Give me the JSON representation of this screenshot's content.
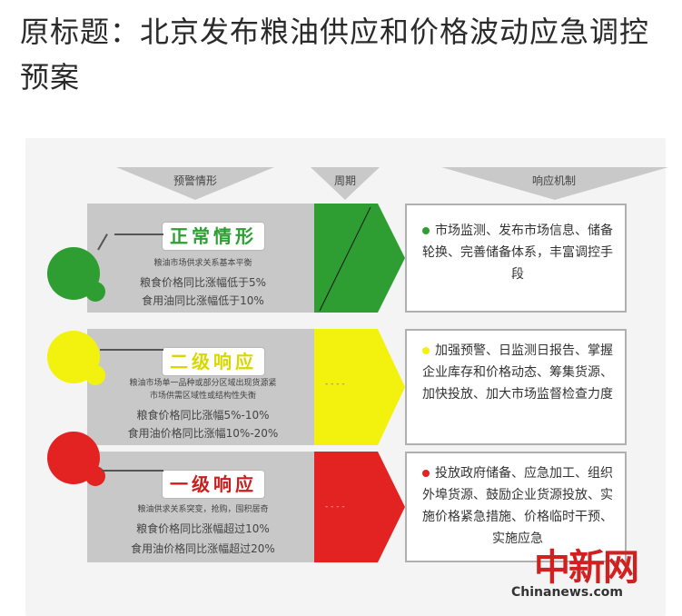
{
  "article": {
    "title": "原标题：北京发布粮油供应和价格波动应急调控预案"
  },
  "graphic": {
    "headers": {
      "warning": "预警情形",
      "cycle": "周期",
      "response": "响应机制"
    },
    "rows": [
      {
        "level": "正常情形",
        "color": "#2e9e32",
        "label_color": "#2e9e32",
        "subtitle": "粮油市场供求关系基本平衡",
        "cond1": "粮食价格同比涨幅低于5%",
        "cond2": "食用油同比涨幅低于10%",
        "middle_text": "",
        "actions": "市场监测、发布市场信息、储备轮换、完善储备体系，丰富调控手段"
      },
      {
        "level": "二级响应",
        "color": "#f2f20e",
        "label_color": "#d8d800",
        "subtitle1": "粮油市场单一品种或部分区域出现货源紧",
        "subtitle2": "市场供需区域性或结构性失衡",
        "cond1": "粮食价格同比涨幅5%-10%",
        "cond2": "食用油价格同比涨幅10%-20%",
        "middle_text": "- - - -",
        "actions": "加强预警、日监测日报告、掌握企业库存和价格动态、筹集货源、加快投放、加大市场监督检查力度"
      },
      {
        "level": "一级响应",
        "color": "#e32222",
        "label_color": "#c81e1e",
        "subtitle": "粮油供求关系突变，抢购，囤积居奇",
        "cond1": "粮食价格同比涨幅超过10%",
        "cond2": "食用油价格同比涨幅超过20%",
        "middle_text": "- - - -",
        "actions": "投放政府储备、应急加工、组织外埠货源、鼓励企业货源投放、实施价格紧急措施、价格临时干预、实施应急"
      }
    ]
  },
  "watermark": {
    "brand": "中新网",
    "site": "Chinanews.com"
  }
}
